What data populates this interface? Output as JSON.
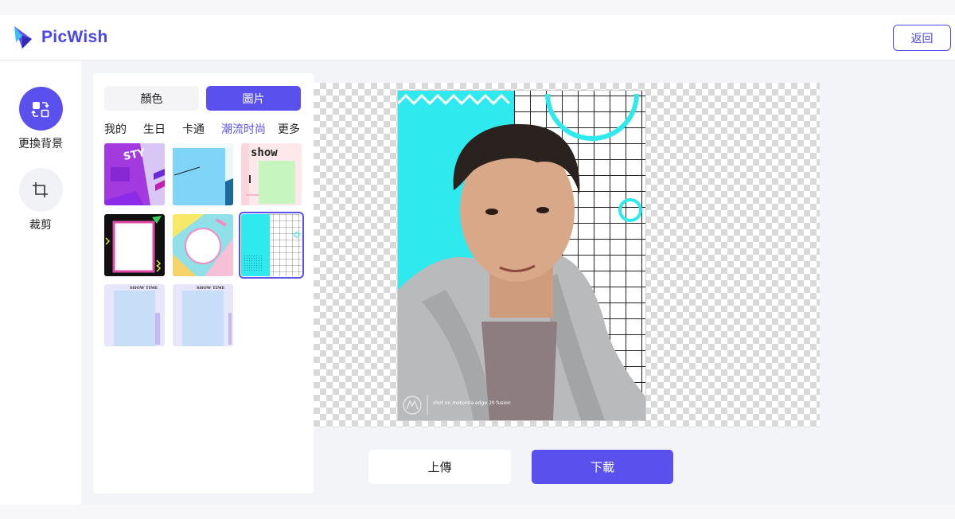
{
  "app": {
    "name": "PicWish",
    "brand_color": "#5a50ee"
  },
  "header": {
    "back_label": "返回"
  },
  "sidebar": {
    "items": [
      {
        "label": "更換背景",
        "icon": "swap-background-icon",
        "active": true
      },
      {
        "label": "裁剪",
        "icon": "crop-icon",
        "active": false
      }
    ]
  },
  "panel": {
    "tabs": [
      {
        "label": "顏色",
        "active": false
      },
      {
        "label": "圖片",
        "active": true
      }
    ],
    "categories": [
      {
        "label": "我的",
        "active": false
      },
      {
        "label": "生日",
        "active": false
      },
      {
        "label": "卡通",
        "active": false
      },
      {
        "label": "潮流时尚",
        "active": true
      },
      {
        "label": "更多",
        "active": false
      }
    ],
    "thumbnails": [
      {
        "name": "purple-style",
        "text": "STY"
      },
      {
        "name": "blue-line"
      },
      {
        "name": "green-show",
        "text": "show"
      },
      {
        "name": "black-frame"
      },
      {
        "name": "pastel-circle"
      },
      {
        "name": "cyan-grid",
        "selected": true
      },
      {
        "name": "showtime-1",
        "text": "SHOW TIME"
      },
      {
        "name": "showtime-2",
        "text": "SHOW TIME"
      }
    ]
  },
  "preview": {
    "watermark": "shot on motorola edge 20 fusion"
  },
  "actions": {
    "upload_label": "上傳",
    "download_label": "下載"
  }
}
